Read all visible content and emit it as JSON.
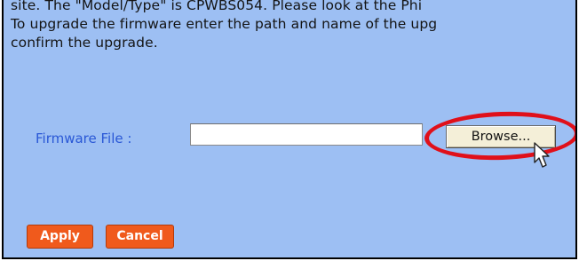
{
  "instructions": {
    "lines": [
      "site. The \"Model/Type\" is CPWBS054. Please look at the Phi",
      "To upgrade the firmware enter the path and name of the upg",
      "confirm the upgrade."
    ]
  },
  "firmware": {
    "label": "Firmware File :",
    "value": "",
    "browse_label": "Browse..."
  },
  "actions": {
    "apply_label": "Apply",
    "cancel_label": "Cancel"
  },
  "colors": {
    "background": "#9dbff3",
    "label_blue": "#2a58d6",
    "button_orange": "#f05a1c",
    "highlight_red": "#e0101a"
  }
}
